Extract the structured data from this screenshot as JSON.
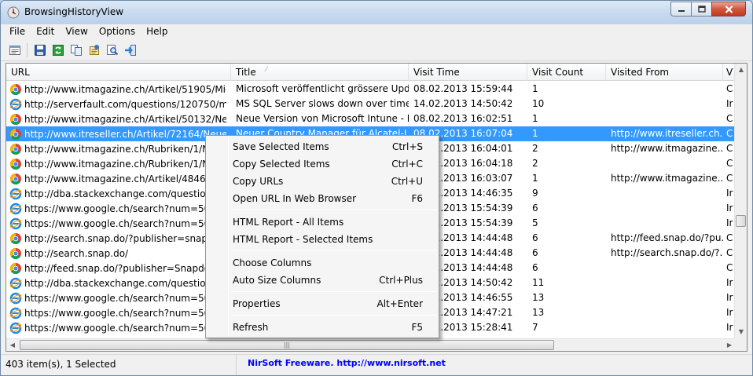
{
  "window": {
    "title": "BrowsingHistoryView"
  },
  "menu": [
    "File",
    "Edit",
    "View",
    "Options",
    "Help"
  ],
  "toolbar": {
    "icons": [
      "properties-icon",
      "save-icon",
      "refresh-icon",
      "copy-icon",
      "html-report-icon",
      "find-icon",
      "exit-icon"
    ]
  },
  "columns": [
    "URL",
    "Title",
    "Visit Time",
    "Visit Count",
    "Visited From",
    "V"
  ],
  "rows": [
    {
      "browser": "chrome",
      "url": "http://www.itmagazine.ch/Artikel/51905/Micro...",
      "title": "Microsoft veröffentlicht grössere Upda...",
      "time": "08.02.2013 15:59:44",
      "count": "1",
      "from": "",
      "extra": "C"
    },
    {
      "browser": "ie",
      "url": "http://serverfault.com/questions/120750/ms-s...",
      "title": "MS SQL Server slows down over time? ...",
      "time": "14.02.2013 14:50:42",
      "count": "10",
      "from": "",
      "extra": "Ir"
    },
    {
      "browser": "chrome",
      "url": "http://www.itmagazine.ch/Artikel/50132/Neue_...",
      "title": "Neue Version von Microsoft Intune - IT...",
      "time": "08.02.2013 16:02:51",
      "count": "1",
      "from": "",
      "extra": "C"
    },
    {
      "browser": "chrome",
      "url": "http://www.itreseller.ch/Artikel/72164/Neuer_C...",
      "title": "Neuer Country Manager für Alcatel-Lu...",
      "time": "08.02.2013 16:07:04",
      "count": "1",
      "from": "http://www.itreseller.ch...",
      "extra": "C",
      "selected": true
    },
    {
      "browser": "chrome",
      "url": "http://www.itmagazine.ch/Rubriken/1/Newsticker...",
      "title": "",
      "time": "08.02.2013 16:04:01",
      "count": "2",
      "from": "http://www.itmagazine....",
      "extra": "C"
    },
    {
      "browser": "chrome",
      "url": "http://www.itmagazine.ch/Rubriken/1/Newsticker...",
      "title": "",
      "time": "08.02.2013 16:04:18",
      "count": "2",
      "from": "",
      "extra": "C"
    },
    {
      "browser": "chrome",
      "url": "http://www.itmagazine.ch/Artikel/48463/PC...",
      "title": "",
      "time": "08.02.2013 16:03:07",
      "count": "1",
      "from": "http://www.itmagazine....",
      "extra": "C"
    },
    {
      "browser": "ie",
      "url": "http://dba.stackexchange.com/questions/6...",
      "title": "",
      "time": "14.02.2013 14:46:35",
      "count": "9",
      "from": "",
      "extra": "Ir"
    },
    {
      "browser": "ie",
      "url": "https://www.google.ch/search?num=50&hl=...",
      "title": "",
      "time": "14.02.2013 15:54:39",
      "count": "6",
      "from": "",
      "extra": "Ir"
    },
    {
      "browser": "ie",
      "url": "https://www.google.ch/search?num=50&hl=...",
      "title": "",
      "time": "14.02.2013 15:54:39",
      "count": "5",
      "from": "",
      "extra": "Ir"
    },
    {
      "browser": "chrome",
      "url": "http://search.snap.do/?publisher=snapdoin...",
      "title": "",
      "time": "08.02.2013 14:44:48",
      "count": "6",
      "from": "http://feed.snap.do/?pu...",
      "extra": "C"
    },
    {
      "browser": "chrome",
      "url": "http://search.snap.do/",
      "title": "",
      "time": "08.02.2013 14:44:48",
      "count": "6",
      "from": "http://search.snap.do/?...",
      "extra": "C"
    },
    {
      "browser": "chrome",
      "url": "http://feed.snap.do/?publisher=SnapdolMo...",
      "title": "",
      "time": "08.02.2013 14:44:48",
      "count": "6",
      "from": "",
      "extra": "C"
    },
    {
      "browser": "ie",
      "url": "http://dba.stackexchange.com/questions/2...",
      "title": "",
      "time": "14.02.2013 14:50:42",
      "count": "11",
      "from": "",
      "extra": "Ir"
    },
    {
      "browser": "ie",
      "url": "https://www.google.ch/search?num=50&hl=...",
      "title": "",
      "time": "14.02.2013 14:46:55",
      "count": "13",
      "from": "",
      "extra": "Ir"
    },
    {
      "browser": "ie",
      "url": "https://www.google.ch/search?num=50&hl=...",
      "title": "",
      "time": "14.02.2013 14:47:21",
      "count": "13",
      "from": "",
      "extra": "Ir"
    },
    {
      "browser": "ie",
      "url": "https://www.google.ch/search?num=50&hl=...",
      "title": "",
      "time": "14.02.2013 15:28:41",
      "count": "7",
      "from": "",
      "extra": "Ir"
    }
  ],
  "context_menu": [
    {
      "label": "Save Selected Items",
      "shortcut": "Ctrl+S"
    },
    {
      "label": "Copy Selected Items",
      "shortcut": "Ctrl+C"
    },
    {
      "label": "Copy URLs",
      "shortcut": "Ctrl+U"
    },
    {
      "label": "Open URL In Web Browser",
      "shortcut": "F6"
    },
    {
      "separator": true
    },
    {
      "label": "HTML Report - All Items",
      "shortcut": ""
    },
    {
      "label": "HTML Report - Selected Items",
      "shortcut": ""
    },
    {
      "separator": true
    },
    {
      "label": "Choose Columns",
      "shortcut": ""
    },
    {
      "label": "Auto Size Columns",
      "shortcut": "Ctrl+Plus"
    },
    {
      "separator": true
    },
    {
      "label": "Properties",
      "shortcut": "Alt+Enter"
    },
    {
      "separator": true
    },
    {
      "label": "Refresh",
      "shortcut": "F5"
    }
  ],
  "status": {
    "count": "403 item(s), 1 Selected",
    "link": "NirSoft Freeware.  http://www.nirsoft.net"
  },
  "colors": {
    "selection": "#3399ff",
    "link": "#0000ff"
  }
}
